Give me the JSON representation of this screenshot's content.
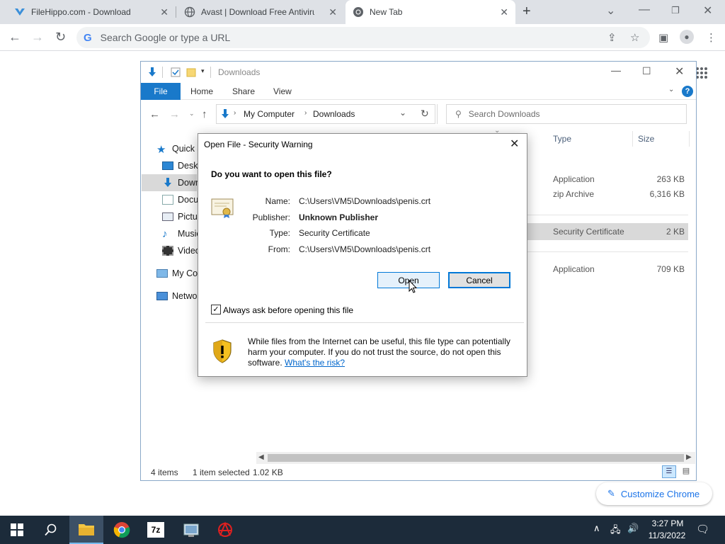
{
  "browser": {
    "tabs": [
      {
        "title": "FileHippo.com - Download Free Software"
      },
      {
        "title": "Avast | Download Free Antivirus & VPN"
      },
      {
        "title": "New Tab"
      }
    ],
    "omnibox_placeholder": "Search Google or type a URL",
    "customize_label": "Customize Chrome"
  },
  "explorer": {
    "title": "Downloads",
    "ribbon": {
      "file": "File",
      "home": "Home",
      "share": "Share",
      "view": "View"
    },
    "address": {
      "root": "My Computer",
      "current": "Downloads"
    },
    "search_placeholder": "Search Downloads",
    "nav": [
      {
        "label": "Quick access"
      },
      {
        "label": "Desktop"
      },
      {
        "label": "Downloads"
      },
      {
        "label": "Documents"
      },
      {
        "label": "Pictures"
      },
      {
        "label": "Music"
      },
      {
        "label": "Videos"
      },
      {
        "label": "My Computer"
      },
      {
        "label": "Network"
      }
    ],
    "columns": {
      "type": "Type",
      "size": "Size"
    },
    "rows": [
      {
        "type": "Application",
        "size": "263 KB"
      },
      {
        "type": "zip Archive",
        "size": "6,316 KB"
      },
      {
        "type": "Security Certificate",
        "size": "2 KB"
      },
      {
        "type": "Application",
        "size": "709 KB"
      }
    ],
    "status": {
      "items": "4 items",
      "selected": "1 item selected",
      "size": "1.02 KB"
    }
  },
  "dialog": {
    "title": "Open File - Security Warning",
    "question": "Do you want to open this file?",
    "fields": {
      "name_label": "Name:",
      "name": "C:\\Users\\VM5\\Downloads\\penis.crt",
      "publisher_label": "Publisher:",
      "publisher": "Unknown Publisher",
      "type_label": "Type:",
      "type": "Security Certificate",
      "from_label": "From:",
      "from": "C:\\Users\\VM5\\Downloads\\penis.crt"
    },
    "open_label": "Open",
    "cancel_label": "Cancel",
    "checkbox_label": "Always ask before opening this file",
    "checkbox_checked": true,
    "warning_text": "While files from the Internet can be useful, this file type can potentially harm your computer. If you do not trust the source, do not open this software.",
    "risk_link": "What's the risk?"
  },
  "taskbar": {
    "time": "3:27 PM",
    "date": "11/3/2022"
  },
  "colors": {
    "explorer_accent": "#1979ca",
    "selection": "#cce8ff",
    "taskbar": "#1c2b3a",
    "link": "#0066cc"
  }
}
